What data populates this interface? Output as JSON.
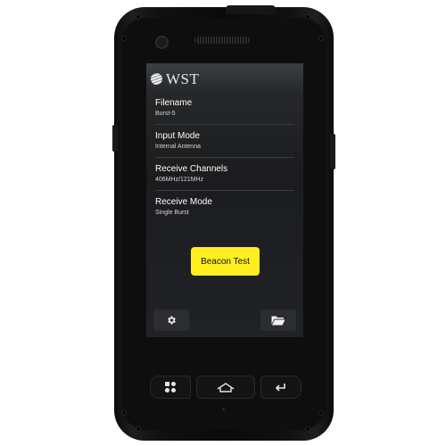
{
  "app": {
    "logo_text": "WST"
  },
  "settings": [
    {
      "label": "Filename",
      "value": "Burst-5"
    },
    {
      "label": "Input Mode",
      "value": "Internal Antenna"
    },
    {
      "label": "Receive Channels",
      "value": "406MHz/121MHz"
    },
    {
      "label": "Receive Mode",
      "value": "Single Burst"
    }
  ],
  "actions": {
    "beacon_test_label": "Beacon Test",
    "accent_color": "#ffef1f"
  },
  "toolbar": {
    "left_icon": "gear-icon",
    "right_icon": "folder-icon"
  },
  "hardware_keys": {
    "left_icon": "menu-icon",
    "center_icon": "home-icon",
    "right_icon": "back-icon"
  }
}
